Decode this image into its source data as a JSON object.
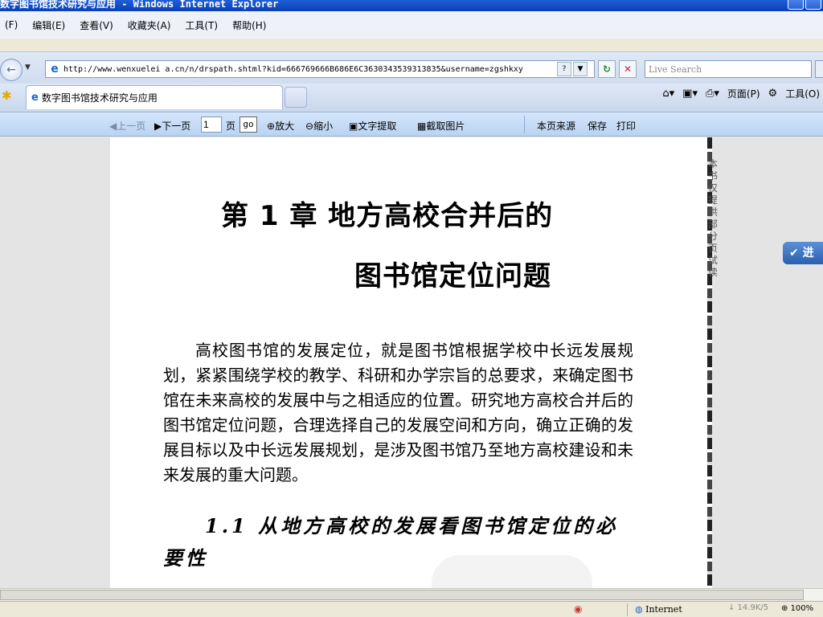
{
  "window": {
    "title": "数字图书馆技术研究与应用 - Windows Internet Explorer"
  },
  "menu": {
    "items": [
      "(F)",
      "编辑(E)",
      "查看(V)",
      "收藏夹(A)",
      "工具(T)",
      "帮助(H)"
    ]
  },
  "address": {
    "url": "http://www.wenxuelei a.cn/n/drspath.shtml?kid=666769666B686E6C3630343539313835&username=zgshkxy",
    "search_placeholder": "Live Search"
  },
  "tab": {
    "label": "数字图书馆技术研究与应用"
  },
  "commandbar": {
    "page_label": "页面(P)",
    "tools_label": "工具(O)"
  },
  "reader_toolbar": {
    "prev": "上一页",
    "next": "下一页",
    "page_value": "1",
    "page_label": "页",
    "go": "go",
    "zoom_in": "放大",
    "zoom_out": "缩小",
    "text_extract": "文字提取",
    "capture_image": "截取图片",
    "source": "本页来源",
    "save": "保存",
    "print": "打印"
  },
  "document": {
    "chapter_line1": "第 1 章   地方高校合并后的",
    "chapter_line2": "图书馆定位问题",
    "paragraph": "高校图书馆的发展定位，就是图书馆根据学校中长远发展规划，紧紧围绕学校的教学、科研和办学宗旨的总要求，来确定图书馆在未来高校的发展中与之相适应的位置。研究地方高校合并后的图书馆定位问题，合理选择自己的发展空间和方向，确立正确的发展目标以及中长远发展规划，是涉及图书馆乃至地方高校建设和未来发展的重大问题。",
    "section_title": "1.1  从地方高校的发展看图书馆定位的必要性"
  },
  "side_notice": "本书仅提供部分页试读",
  "float_button": "进",
  "status": {
    "zone": "Internet",
    "speed": "↓ 14.9K/5",
    "zoom": "100%"
  },
  "colors": {
    "titlebar": "#0a3fb8",
    "reader_toolbar": "#b9d3f2",
    "page_bg": "#ffffff",
    "gutter": "#e4e4e4"
  }
}
